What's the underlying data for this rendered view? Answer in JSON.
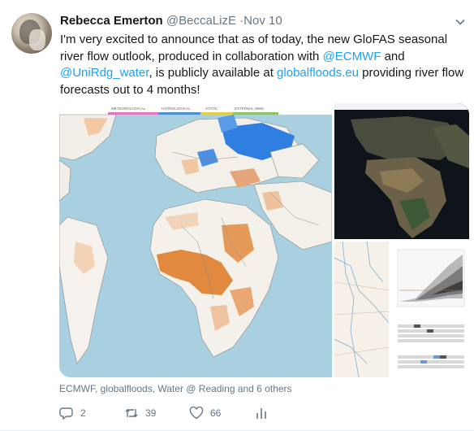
{
  "tweet": {
    "author_name": "Rebecca Emerton",
    "handle": "@BeccaLizE",
    "separator": "·",
    "time": "Nov 10",
    "text_parts": {
      "t1": "I'm very excited to announce that as of today, the new GloFAS seasonal river flow outlook, produced in collaboration with ",
      "mention1": "@ECMWF",
      "t2": " and ",
      "mention2": "@UniRdg_water",
      "t3": ", is publicly available at ",
      "url": "globalfloods.eu",
      "t4": " providing river flow forecasts out to 4 months!"
    },
    "media": {
      "map_tabs": [
        "METEOROLOGICAL",
        "HYDROLOGICAL",
        "STATIC",
        "EXTERNAL WMS"
      ]
    },
    "place": "ECMWF, globalfloods, Water @ Reading and 6 others",
    "actions": {
      "reply_count": "2",
      "retweet_count": "39",
      "like_count": "66"
    },
    "icons": [
      "reply-icon",
      "retweet-icon",
      "like-icon",
      "analytics-icon",
      "chevron-down-icon"
    ],
    "colors": {
      "link": "#1da1f2",
      "muted": "#657786"
    }
  }
}
